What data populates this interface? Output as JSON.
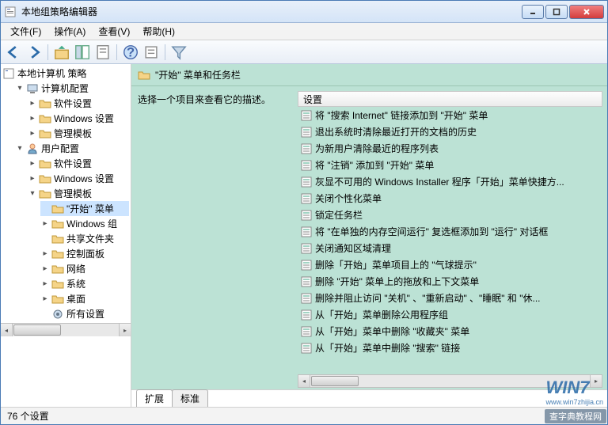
{
  "window": {
    "title": "本地组策略编辑器"
  },
  "menu": {
    "file": "文件(F)",
    "action": "操作(A)",
    "view": "查看(V)",
    "help": "帮助(H)"
  },
  "tree": {
    "root": "本地计算机 策略",
    "computer_config": "计算机配置",
    "cc_software": "软件设置",
    "cc_windows": "Windows 设置",
    "cc_admin": "管理模板",
    "user_config": "用户配置",
    "uc_software": "软件设置",
    "uc_windows": "Windows 设置",
    "uc_admin": "管理模板",
    "start_menu": "\"开始\" 菜单",
    "windows_comp": "Windows 组",
    "shared_folders": "共享文件夹",
    "control_panel": "控制面板",
    "network": "网络",
    "system": "系统",
    "desktop": "桌面",
    "all_settings": "所有设置"
  },
  "content": {
    "header_title": "\"开始\" 菜单和任务栏",
    "description_prompt": "选择一个项目来查看它的描述。",
    "column_header": "设置"
  },
  "settings": [
    "将 \"搜索 Internet\" 链接添加到 \"开始\" 菜单",
    "退出系统时清除最近打开的文档的历史",
    "为新用户清除最近的程序列表",
    "将 \"注销\" 添加到 \"开始\" 菜单",
    "灰显不可用的 Windows Installer 程序「开始」菜单快捷方...",
    "关闭个性化菜单",
    "锁定任务栏",
    "将 \"在单独的内存空间运行\" 复选框添加到 \"运行\" 对话框",
    "关闭通知区域清理",
    "删除「开始」菜单项目上的 \"气球提示\"",
    "删除 \"开始\" 菜单上的拖放和上下文菜单",
    "删除并阻止访问 \"关机\" 、\"重新启动\" 、\"睡眠\" 和 \"休...",
    "从「开始」菜单删除公用程序组",
    "从「开始」菜单中删除 \"收藏夹\" 菜单",
    "从「开始」菜单中删除 \"搜索\" 链接"
  ],
  "tabs": {
    "extended": "扩展",
    "standard": "标准"
  },
  "status": {
    "count": "76 个设置"
  },
  "watermark": {
    "main": "WIN7",
    "url": "www.win7zhijia.cn",
    "bar": "查字典教程网"
  }
}
